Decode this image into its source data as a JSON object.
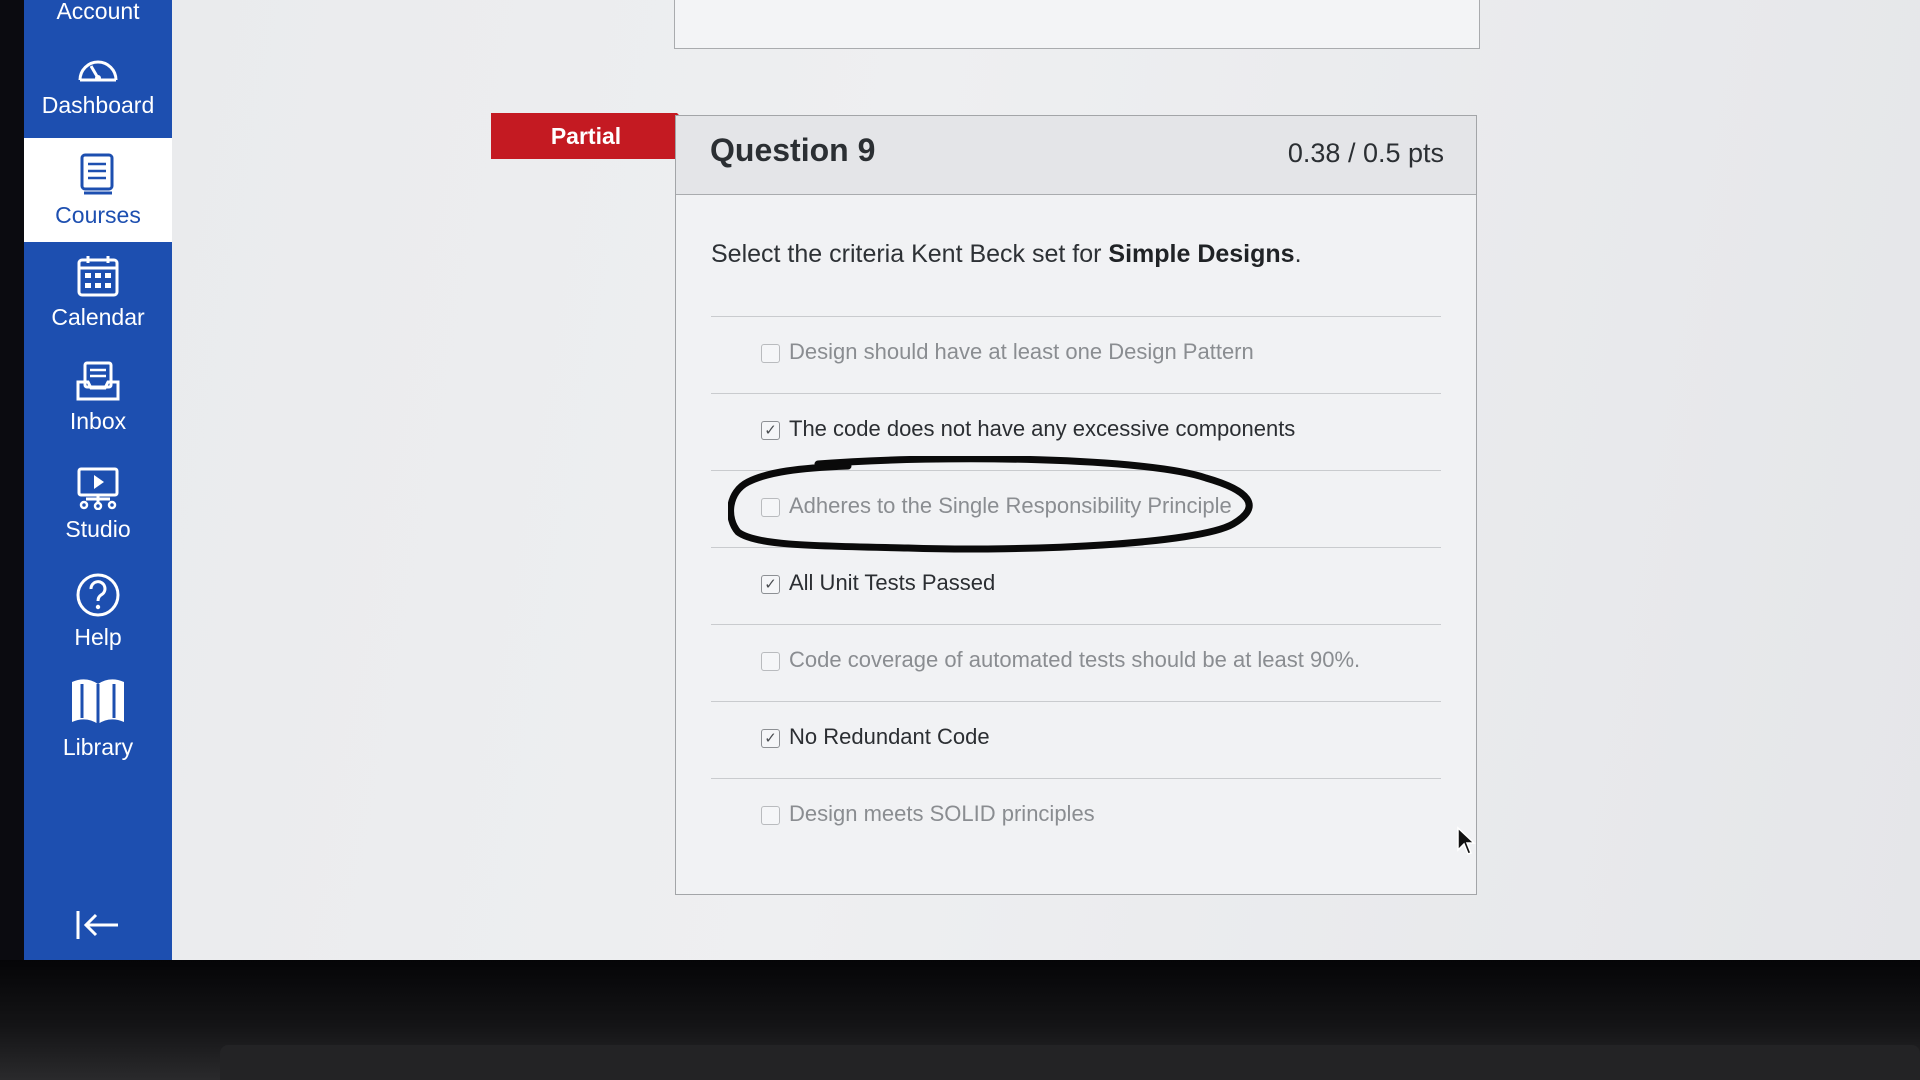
{
  "nav": {
    "items": [
      {
        "label": "Account",
        "icon": "account-icon"
      },
      {
        "label": "Dashboard",
        "icon": "dashboard-icon"
      },
      {
        "label": "Courses",
        "icon": "courses-icon"
      },
      {
        "label": "Calendar",
        "icon": "calendar-icon"
      },
      {
        "label": "Inbox",
        "icon": "inbox-icon"
      },
      {
        "label": "Studio",
        "icon": "studio-icon"
      },
      {
        "label": "Help",
        "icon": "help-icon"
      },
      {
        "label": "Library",
        "icon": "library-icon"
      }
    ],
    "active": "Courses"
  },
  "question": {
    "badge": "Partial",
    "title": "Question 9",
    "points": "0.38 / 0.5 pts",
    "prompt_prefix": "Select the criteria Kent Beck set for ",
    "prompt_bold": "Simple Designs",
    "prompt_suffix": ".",
    "answers": [
      {
        "text": "Design should have at least one Design Pattern",
        "checked": false
      },
      {
        "text": "The code does not have any excessive components",
        "checked": true
      },
      {
        "text": "Adheres to the Single Responsibility Principle",
        "checked": false
      },
      {
        "text": "All Unit Tests Passed",
        "checked": true
      },
      {
        "text": "Code coverage of automated tests should be at least 90%.",
        "checked": false
      },
      {
        "text": "No Redundant Code",
        "checked": true
      },
      {
        "text": "Design meets SOLID principles",
        "checked": false
      }
    ]
  },
  "colors": {
    "nav_blue": "#1d4fb0",
    "badge_red": "#c41a22",
    "ink_circle": "#0a0a0a"
  }
}
